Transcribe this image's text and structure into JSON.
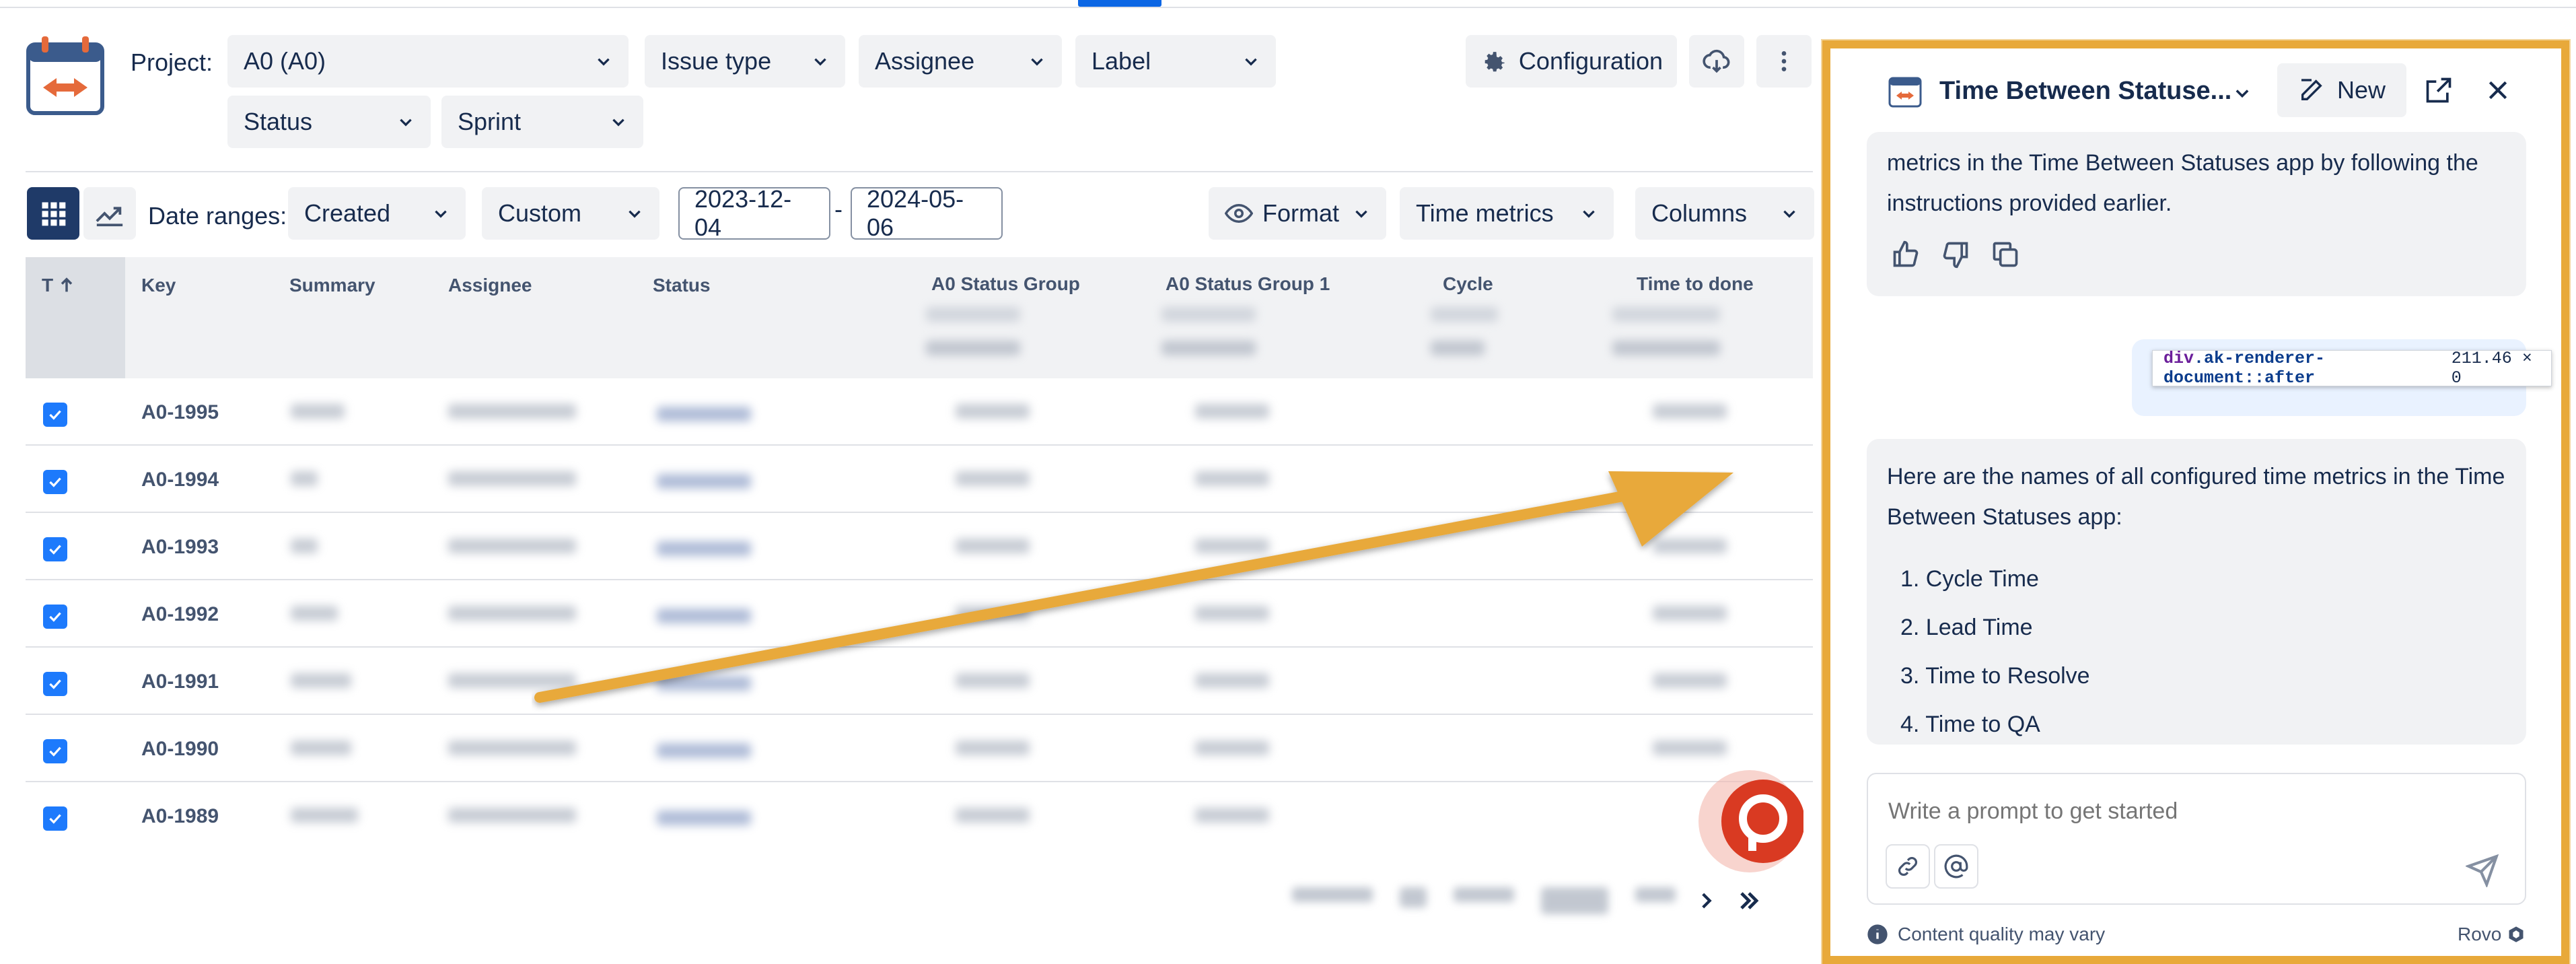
{
  "toolbar": {
    "project_label": "Project:",
    "project_value": "A0 (A0)",
    "issue_type": "Issue type",
    "assignee": "Assignee",
    "label": "Label",
    "status": "Status",
    "sprint": "Sprint",
    "configuration": "Configuration"
  },
  "filters": {
    "date_ranges_label": "Date ranges:",
    "date_field": "Created",
    "range_type": "Custom",
    "date_from": "2023-12-04",
    "date_separator": "-",
    "date_to": "2024-05-06",
    "format": "Format",
    "time_metrics": "Time metrics",
    "columns": "Columns"
  },
  "table": {
    "sort_header": "T",
    "headers": [
      "Key",
      "Summary",
      "Assignee",
      "Status",
      "A0 Status Group",
      "A0 Status Group 1",
      "Cycle",
      "Time to done"
    ],
    "rows": [
      {
        "key": "A0-1995"
      },
      {
        "key": "A0-1994"
      },
      {
        "key": "A0-1993"
      },
      {
        "key": "A0-1992"
      },
      {
        "key": "A0-1991"
      },
      {
        "key": "A0-1990"
      },
      {
        "key": "A0-1989"
      }
    ]
  },
  "chat": {
    "title": "Time Between Statuse...",
    "new_label": "New",
    "previous_reply": "metrics in the Time Between Statuses app by following the instructions provided earlier.",
    "tooltip": {
      "tag": "div",
      "selector": ".ak-renderer-document::after",
      "size": "211.46 × 0"
    },
    "reply_intro": "Here are the names of all configured time metrics in the Time Between Statuses app:",
    "metrics": [
      "1. Cycle Time",
      "2. Lead Time",
      "3. Time to Resolve",
      "4. Time to QA"
    ],
    "prompt_placeholder": "Write a prompt to get started",
    "footer_note": "Content quality may vary",
    "brand": "Rovo"
  },
  "colors": {
    "accent": "#0c66e4",
    "highlight_frame": "#e8a93a",
    "checkbox": "#1d7afc",
    "active_view": "#1f3a68"
  }
}
